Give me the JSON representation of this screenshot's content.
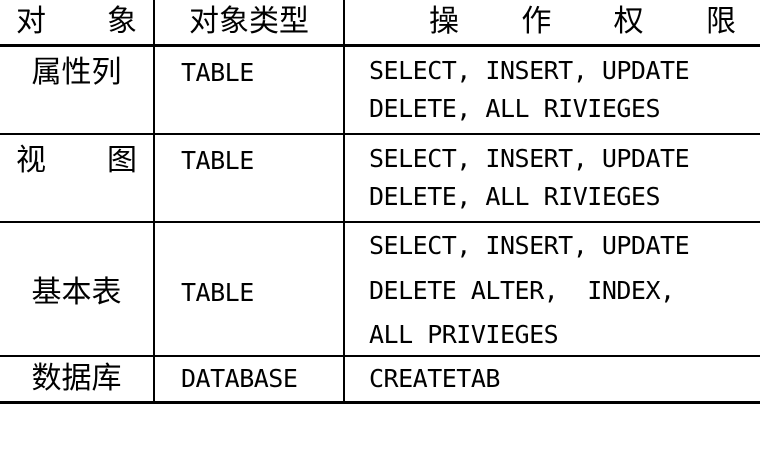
{
  "headers": {
    "object": "对 象",
    "object_chars": [
      "对",
      "象"
    ],
    "object_type": "对象类型",
    "permissions": "操 作 权 限",
    "permissions_chars": [
      "操",
      "作",
      "权",
      "限"
    ]
  },
  "rows": [
    {
      "object": "属性列",
      "object_chars": [],
      "type": "TABLE",
      "permission_lines": [
        "SELECT, INSERT, UPDATE",
        "DELETE, ALL RIVIEGES"
      ]
    },
    {
      "object": "视 图",
      "object_chars": [
        "视",
        "图"
      ],
      "type": "TABLE",
      "permission_lines": [
        "SELECT, INSERT, UPDATE",
        "DELETE, ALL RIVIEGES"
      ]
    },
    {
      "object": "基本表",
      "object_chars": [],
      "type": "TABLE",
      "permission_lines": [
        "SELECT, INSERT, UPDATE",
        "DELETE ALTER,  INDEX,",
        "ALL PRIVIEGES"
      ]
    },
    {
      "object": "数据库",
      "object_chars": [],
      "type": "DATABASE",
      "permission_lines": [
        "CREATETAB"
      ]
    }
  ]
}
